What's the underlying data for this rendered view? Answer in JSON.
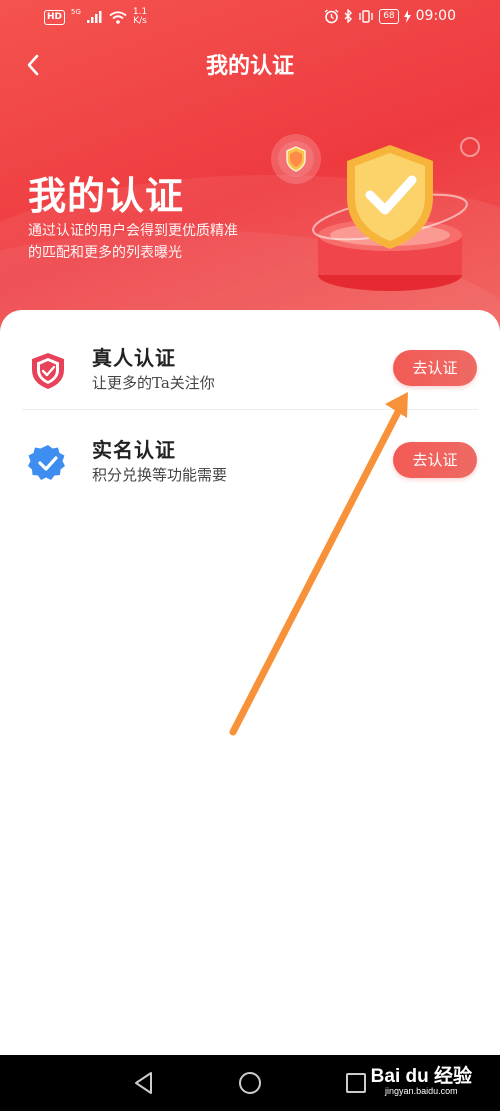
{
  "status_bar": {
    "hd": "HD",
    "network": "5G",
    "speed_value": "1.1",
    "speed_unit": "K/s",
    "battery": "68",
    "time": "09:00"
  },
  "header": {
    "title": "我的认证"
  },
  "hero": {
    "title": "我的认证",
    "description": "通过认证的用户会得到更优质精准的匹配和更多的列表曝光"
  },
  "verifications": [
    {
      "title": "真人认证",
      "subtitle": "让更多的Ta关注你",
      "button": "去认证",
      "icon": "shield-check-icon",
      "icon_color": "#e8425a"
    },
    {
      "title": "实名认证",
      "subtitle": "积分兑换等功能需要",
      "button": "去认证",
      "icon": "badge-check-icon",
      "icon_color": "#3d8ef0"
    }
  ],
  "colors": {
    "primary": "#ee3a3f",
    "button": "#f35a55",
    "annotation_arrow": "#f7923a"
  },
  "watermark": {
    "logo": "Bai du 经验",
    "url": "jingyan.baidu.com"
  }
}
